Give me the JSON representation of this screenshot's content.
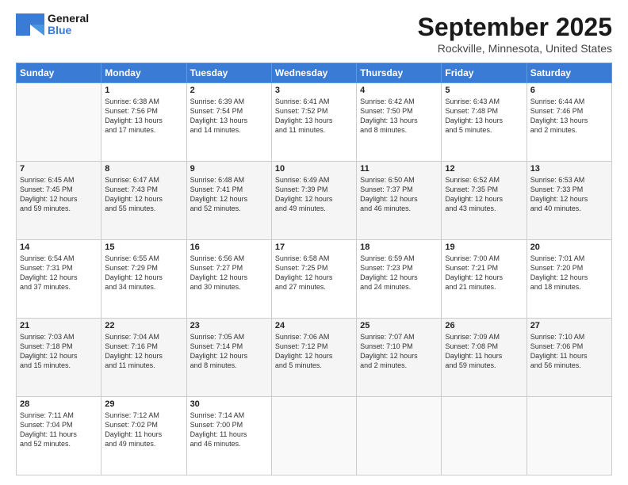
{
  "logo": {
    "line1": "General",
    "line2": "Blue"
  },
  "title": "September 2025",
  "location": "Rockville, Minnesota, United States",
  "weekdays": [
    "Sunday",
    "Monday",
    "Tuesday",
    "Wednesday",
    "Thursday",
    "Friday",
    "Saturday"
  ],
  "weeks": [
    [
      {
        "day": "",
        "info": ""
      },
      {
        "day": "1",
        "info": "Sunrise: 6:38 AM\nSunset: 7:56 PM\nDaylight: 13 hours\nand 17 minutes."
      },
      {
        "day": "2",
        "info": "Sunrise: 6:39 AM\nSunset: 7:54 PM\nDaylight: 13 hours\nand 14 minutes."
      },
      {
        "day": "3",
        "info": "Sunrise: 6:41 AM\nSunset: 7:52 PM\nDaylight: 13 hours\nand 11 minutes."
      },
      {
        "day": "4",
        "info": "Sunrise: 6:42 AM\nSunset: 7:50 PM\nDaylight: 13 hours\nand 8 minutes."
      },
      {
        "day": "5",
        "info": "Sunrise: 6:43 AM\nSunset: 7:48 PM\nDaylight: 13 hours\nand 5 minutes."
      },
      {
        "day": "6",
        "info": "Sunrise: 6:44 AM\nSunset: 7:46 PM\nDaylight: 13 hours\nand 2 minutes."
      }
    ],
    [
      {
        "day": "7",
        "info": "Sunrise: 6:45 AM\nSunset: 7:45 PM\nDaylight: 12 hours\nand 59 minutes."
      },
      {
        "day": "8",
        "info": "Sunrise: 6:47 AM\nSunset: 7:43 PM\nDaylight: 12 hours\nand 55 minutes."
      },
      {
        "day": "9",
        "info": "Sunrise: 6:48 AM\nSunset: 7:41 PM\nDaylight: 12 hours\nand 52 minutes."
      },
      {
        "day": "10",
        "info": "Sunrise: 6:49 AM\nSunset: 7:39 PM\nDaylight: 12 hours\nand 49 minutes."
      },
      {
        "day": "11",
        "info": "Sunrise: 6:50 AM\nSunset: 7:37 PM\nDaylight: 12 hours\nand 46 minutes."
      },
      {
        "day": "12",
        "info": "Sunrise: 6:52 AM\nSunset: 7:35 PM\nDaylight: 12 hours\nand 43 minutes."
      },
      {
        "day": "13",
        "info": "Sunrise: 6:53 AM\nSunset: 7:33 PM\nDaylight: 12 hours\nand 40 minutes."
      }
    ],
    [
      {
        "day": "14",
        "info": "Sunrise: 6:54 AM\nSunset: 7:31 PM\nDaylight: 12 hours\nand 37 minutes."
      },
      {
        "day": "15",
        "info": "Sunrise: 6:55 AM\nSunset: 7:29 PM\nDaylight: 12 hours\nand 34 minutes."
      },
      {
        "day": "16",
        "info": "Sunrise: 6:56 AM\nSunset: 7:27 PM\nDaylight: 12 hours\nand 30 minutes."
      },
      {
        "day": "17",
        "info": "Sunrise: 6:58 AM\nSunset: 7:25 PM\nDaylight: 12 hours\nand 27 minutes."
      },
      {
        "day": "18",
        "info": "Sunrise: 6:59 AM\nSunset: 7:23 PM\nDaylight: 12 hours\nand 24 minutes."
      },
      {
        "day": "19",
        "info": "Sunrise: 7:00 AM\nSunset: 7:21 PM\nDaylight: 12 hours\nand 21 minutes."
      },
      {
        "day": "20",
        "info": "Sunrise: 7:01 AM\nSunset: 7:20 PM\nDaylight: 12 hours\nand 18 minutes."
      }
    ],
    [
      {
        "day": "21",
        "info": "Sunrise: 7:03 AM\nSunset: 7:18 PM\nDaylight: 12 hours\nand 15 minutes."
      },
      {
        "day": "22",
        "info": "Sunrise: 7:04 AM\nSunset: 7:16 PM\nDaylight: 12 hours\nand 11 minutes."
      },
      {
        "day": "23",
        "info": "Sunrise: 7:05 AM\nSunset: 7:14 PM\nDaylight: 12 hours\nand 8 minutes."
      },
      {
        "day": "24",
        "info": "Sunrise: 7:06 AM\nSunset: 7:12 PM\nDaylight: 12 hours\nand 5 minutes."
      },
      {
        "day": "25",
        "info": "Sunrise: 7:07 AM\nSunset: 7:10 PM\nDaylight: 12 hours\nand 2 minutes."
      },
      {
        "day": "26",
        "info": "Sunrise: 7:09 AM\nSunset: 7:08 PM\nDaylight: 11 hours\nand 59 minutes."
      },
      {
        "day": "27",
        "info": "Sunrise: 7:10 AM\nSunset: 7:06 PM\nDaylight: 11 hours\nand 56 minutes."
      }
    ],
    [
      {
        "day": "28",
        "info": "Sunrise: 7:11 AM\nSunset: 7:04 PM\nDaylight: 11 hours\nand 52 minutes."
      },
      {
        "day": "29",
        "info": "Sunrise: 7:12 AM\nSunset: 7:02 PM\nDaylight: 11 hours\nand 49 minutes."
      },
      {
        "day": "30",
        "info": "Sunrise: 7:14 AM\nSunset: 7:00 PM\nDaylight: 11 hours\nand 46 minutes."
      },
      {
        "day": "",
        "info": ""
      },
      {
        "day": "",
        "info": ""
      },
      {
        "day": "",
        "info": ""
      },
      {
        "day": "",
        "info": ""
      }
    ]
  ]
}
